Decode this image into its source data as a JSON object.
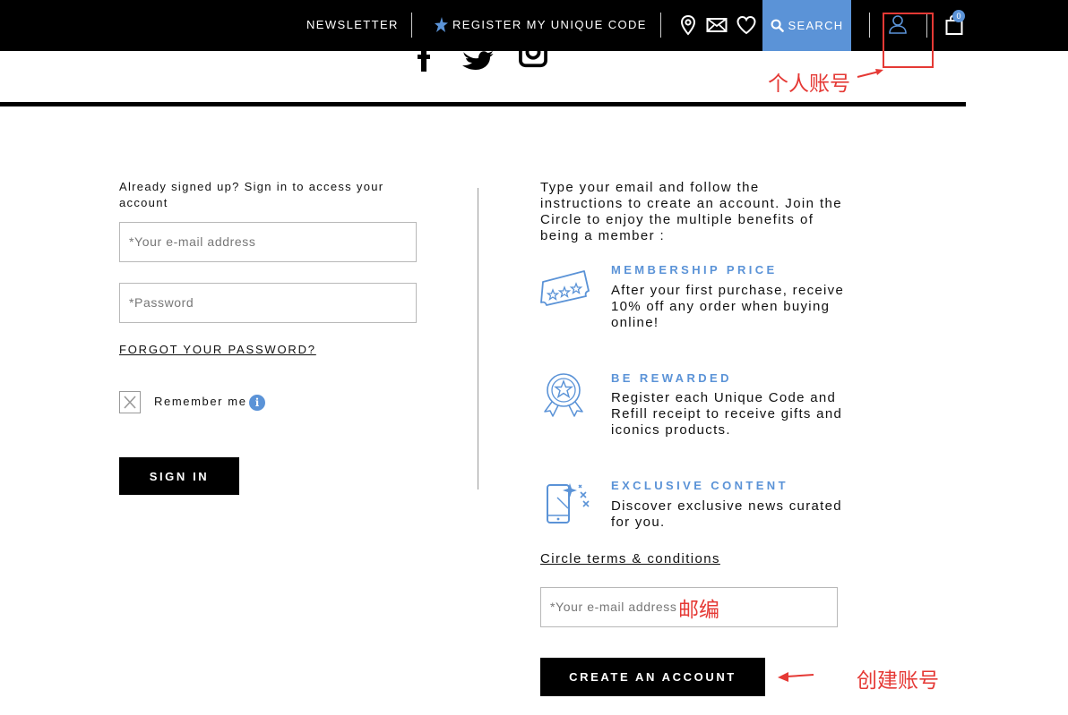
{
  "header": {
    "newsletter_label": "NEWSLETTER",
    "register_code_label": "REGISTER MY UNIQUE CODE",
    "search_label": "SEARCH",
    "cart_count": "0",
    "icons": [
      "star-icon",
      "location-pin-icon",
      "envelope-icon",
      "heart-icon",
      "magnifier-icon",
      "user-icon",
      "shopping-bag-icon"
    ],
    "accent_color": "#5b93d7"
  },
  "social": {
    "icons": [
      "facebook-icon",
      "twitter-icon",
      "instagram-icon"
    ]
  },
  "annotations": {
    "account_label": "个人账号",
    "email_label": "邮编",
    "create_label": "创建账号",
    "color": "#e53935"
  },
  "signin": {
    "intro": "Already signed up? Sign in to access your account",
    "email_placeholder": "*Your e-mail address",
    "password_placeholder": "*Password",
    "forgot_label": "FORGOT YOUR PASSWORD?",
    "remember_label": "Remember me",
    "info_icon_glyph": "i",
    "button_label": "SIGN IN"
  },
  "register": {
    "intro": "Type your email and follow the instructions to create an account. Join the Circle to enjoy the multiple benefits of being a member :",
    "benefits": [
      {
        "icon": "ticket-stars-icon",
        "title": "MEMBERSHIP PRICE",
        "description": "After your first purchase, receive 10% off any order when buying online!"
      },
      {
        "icon": "medal-star-icon",
        "title": "BE REWARDED",
        "description": "Register each Unique Code and Refill receipt to receive gifts and iconics products."
      },
      {
        "icon": "phone-sparkle-icon",
        "title": "EXCLUSIVE CONTENT",
        "description": "Discover exclusive news curated for you."
      }
    ],
    "terms_label": "Circle terms & conditions",
    "email_placeholder": "*Your e-mail address",
    "button_label": "CREATE AN ACCOUNT"
  }
}
